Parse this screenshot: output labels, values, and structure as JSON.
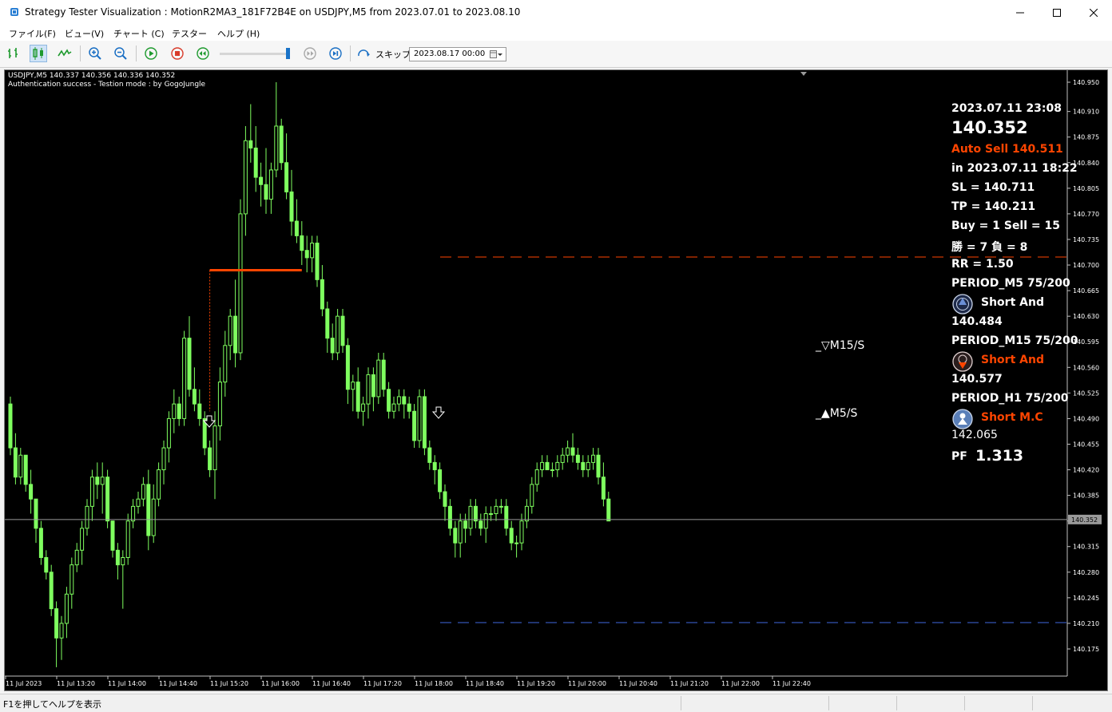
{
  "window": {
    "title": "Strategy Tester Visualization : MotionR2MA3_181F72B4E on USDJPY,M5 from 2023.07.01 to 2023.08.10"
  },
  "menu": [
    "ファイル(F)",
    "ビュー(V)",
    "チャート (C)",
    "テスター",
    "ヘルプ (H)"
  ],
  "toolbar": {
    "skip_label": "スキップ",
    "date_value": "2023.08.17 00:00",
    "slider_position": 0.97
  },
  "chart_header": {
    "symbol_line": "USDJPY,M5  140.337 140.356 140.336 140.352",
    "auth_line": "Authentication success - Testion mode : by GogoJungle"
  },
  "info_panel": {
    "datetime": "2023.07.11 23:08",
    "price": "140.352",
    "auto_sell": "Auto Sell 140.511",
    "in_time": "in 2023.07.11 18:22",
    "sl": "SL = 140.711",
    "tp": "TP = 140.211",
    "buy_sell": "Buy = 1 Sell = 15",
    "win_loss": "勝 = 7  負 = 8",
    "rr": "RR = 1.50",
    "period_m5": "PERIOD_M5 75/200",
    "m5_signal": "Short And",
    "m5_value": "140.484",
    "period_m15": "PERIOD_M15 75/200",
    "m15_signal": "Short And",
    "m15_value": "140.577",
    "period_h1": "PERIOD_H1 75/200",
    "h1_signal": "Short M.C",
    "h1_value": "142.065",
    "pf_label": "PF",
    "pf_value": "1.313"
  },
  "chart_labels": {
    "m15_label": "_▽M15/S",
    "m5_label": "_▲M5/S"
  },
  "status": {
    "help_text": "F1を押してヘルプを表示"
  },
  "colors": {
    "candle": "#7fff5f",
    "background": "#000000",
    "sl_line": "#ff4500",
    "tp_line": "#4169e1",
    "signal_red": "#ff4500",
    "text": "#ffffff"
  },
  "chart_data": {
    "type": "candlestick",
    "symbol": "USDJPY,M5",
    "current_price": 140.352,
    "y_ticks": [
      140.95,
      140.91,
      140.875,
      140.84,
      140.805,
      140.77,
      140.735,
      140.7,
      140.665,
      140.63,
      140.595,
      140.56,
      140.525,
      140.49,
      140.455,
      140.42,
      140.385,
      140.35,
      140.315,
      140.28,
      140.245,
      140.21,
      140.175
    ],
    "x_ticks": [
      "11 Jul 2023",
      "11 Jul 13:20",
      "11 Jul 14:00",
      "11 Jul 14:40",
      "11 Jul 15:20",
      "11 Jul 16:00",
      "11 Jul 16:40",
      "11 Jul 17:20",
      "11 Jul 18:00",
      "11 Jul 18:40",
      "11 Jul 19:20",
      "11 Jul 20:00",
      "11 Jul 20:40",
      "11 Jul 21:20",
      "11 Jul 22:00",
      "11 Jul 22:40"
    ],
    "sl_level": 140.711,
    "tp_level": 140.211,
    "entry_level": 140.693,
    "ohlc": [
      [
        140.51,
        140.52,
        140.44,
        140.45
      ],
      [
        140.45,
        140.47,
        140.4,
        140.41
      ],
      [
        140.41,
        140.45,
        140.4,
        140.44
      ],
      [
        140.44,
        140.44,
        140.39,
        140.4
      ],
      [
        140.4,
        140.42,
        140.36,
        140.38
      ],
      [
        140.38,
        140.38,
        140.32,
        140.34
      ],
      [
        140.34,
        140.35,
        140.29,
        140.3
      ],
      [
        140.3,
        140.31,
        140.27,
        140.28
      ],
      [
        140.28,
        140.29,
        140.22,
        140.23
      ],
      [
        140.23,
        140.24,
        140.15,
        140.19
      ],
      [
        140.19,
        140.22,
        140.16,
        140.21
      ],
      [
        140.21,
        140.26,
        140.19,
        140.25
      ],
      [
        140.25,
        140.3,
        140.23,
        140.29
      ],
      [
        140.29,
        140.32,
        140.28,
        140.31
      ],
      [
        140.31,
        140.35,
        140.29,
        140.34
      ],
      [
        140.34,
        140.38,
        140.33,
        140.37
      ],
      [
        140.37,
        140.42,
        140.35,
        140.41
      ],
      [
        140.41,
        140.43,
        140.38,
        140.4
      ],
      [
        140.4,
        140.43,
        140.36,
        140.41
      ],
      [
        140.41,
        140.42,
        140.34,
        140.35
      ],
      [
        140.35,
        140.35,
        140.3,
        140.31
      ],
      [
        140.31,
        140.32,
        140.27,
        140.29
      ],
      [
        140.29,
        140.31,
        140.23,
        140.3
      ],
      [
        140.3,
        140.36,
        140.29,
        140.35
      ],
      [
        140.35,
        140.38,
        140.34,
        140.37
      ],
      [
        140.37,
        140.39,
        140.36,
        140.38
      ],
      [
        140.38,
        140.41,
        140.37,
        140.4
      ],
      [
        140.4,
        140.42,
        140.31,
        140.33
      ],
      [
        140.33,
        140.4,
        140.32,
        140.38
      ],
      [
        140.38,
        140.43,
        140.37,
        140.42
      ],
      [
        140.42,
        140.46,
        140.4,
        140.45
      ],
      [
        140.45,
        140.5,
        140.43,
        140.49
      ],
      [
        140.49,
        140.53,
        140.47,
        140.51
      ],
      [
        140.51,
        140.52,
        140.48,
        140.49
      ],
      [
        140.49,
        140.61,
        140.48,
        140.6
      ],
      [
        140.6,
        140.63,
        140.52,
        140.53
      ],
      [
        140.53,
        140.56,
        140.5,
        140.51
      ],
      [
        140.51,
        140.53,
        140.48,
        140.49
      ],
      [
        140.49,
        140.5,
        140.44,
        140.45
      ],
      [
        140.45,
        140.46,
        140.41,
        140.42
      ],
      [
        140.42,
        140.5,
        140.38,
        140.48
      ],
      [
        140.48,
        140.56,
        140.46,
        140.54
      ],
      [
        140.54,
        140.61,
        140.52,
        140.59
      ],
      [
        140.59,
        140.64,
        140.57,
        140.63
      ],
      [
        140.63,
        140.68,
        140.56,
        140.58
      ],
      [
        140.58,
        140.79,
        140.57,
        140.77
      ],
      [
        140.77,
        140.89,
        140.74,
        140.87
      ],
      [
        140.87,
        140.92,
        140.84,
        140.86
      ],
      [
        140.86,
        140.89,
        140.8,
        140.82
      ],
      [
        140.82,
        140.84,
        140.78,
        140.81
      ],
      [
        140.81,
        140.86,
        140.77,
        140.79
      ],
      [
        140.79,
        140.84,
        140.77,
        140.83
      ],
      [
        140.83,
        140.95,
        140.82,
        140.89
      ],
      [
        140.89,
        140.9,
        140.83,
        140.84
      ],
      [
        140.84,
        140.88,
        140.79,
        140.8
      ],
      [
        140.8,
        140.83,
        140.74,
        140.76
      ],
      [
        140.76,
        140.79,
        140.73,
        140.74
      ],
      [
        140.74,
        140.76,
        140.7,
        140.72
      ],
      [
        140.72,
        140.74,
        140.69,
        140.71
      ],
      [
        140.71,
        140.74,
        140.69,
        140.73
      ],
      [
        140.73,
        140.74,
        140.67,
        140.68
      ],
      [
        140.68,
        140.7,
        140.63,
        140.64
      ],
      [
        140.64,
        140.65,
        140.58,
        140.6
      ],
      [
        140.6,
        140.62,
        140.57,
        140.58
      ],
      [
        140.58,
        140.64,
        140.57,
        140.63
      ],
      [
        140.63,
        140.64,
        140.58,
        140.59
      ],
      [
        140.59,
        140.6,
        140.51,
        140.53
      ],
      [
        140.53,
        140.55,
        140.5,
        140.54
      ],
      [
        140.54,
        140.56,
        140.49,
        140.5
      ],
      [
        140.5,
        140.52,
        140.48,
        140.51
      ],
      [
        140.51,
        140.56,
        140.49,
        140.55
      ],
      [
        140.55,
        140.56,
        140.5,
        140.52
      ],
      [
        140.52,
        140.58,
        140.51,
        140.57
      ],
      [
        140.57,
        140.58,
        140.52,
        140.53
      ],
      [
        140.53,
        140.54,
        140.49,
        140.5
      ],
      [
        140.5,
        140.52,
        140.49,
        140.51
      ],
      [
        140.51,
        140.53,
        140.5,
        140.52
      ],
      [
        140.52,
        140.53,
        140.49,
        140.51
      ],
      [
        140.51,
        140.52,
        140.49,
        140.5
      ],
      [
        140.5,
        140.51,
        140.45,
        140.46
      ],
      [
        140.46,
        140.53,
        140.45,
        140.52
      ],
      [
        140.52,
        140.53,
        140.44,
        140.45
      ],
      [
        140.45,
        140.46,
        140.42,
        140.43
      ],
      [
        140.43,
        140.44,
        140.4,
        140.42
      ],
      [
        140.42,
        140.43,
        140.38,
        140.39
      ],
      [
        140.39,
        140.4,
        140.35,
        140.37
      ],
      [
        140.37,
        140.38,
        140.33,
        140.34
      ],
      [
        140.34,
        140.35,
        140.3,
        140.32
      ],
      [
        140.32,
        140.36,
        140.3,
        140.35
      ],
      [
        140.35,
        140.36,
        140.32,
        140.34
      ],
      [
        140.34,
        140.38,
        140.33,
        140.37
      ],
      [
        140.37,
        140.38,
        140.34,
        140.35
      ],
      [
        140.35,
        140.36,
        140.33,
        140.34
      ],
      [
        140.34,
        140.37,
        140.32,
        140.36
      ],
      [
        140.36,
        140.37,
        140.35,
        140.36
      ],
      [
        140.36,
        140.38,
        140.35,
        140.37
      ],
      [
        140.37,
        140.38,
        140.36,
        140.37
      ],
      [
        140.37,
        140.38,
        140.33,
        140.34
      ],
      [
        140.34,
        140.35,
        140.31,
        140.32
      ],
      [
        140.32,
        140.33,
        140.3,
        140.32
      ],
      [
        140.32,
        140.36,
        140.31,
        140.35
      ],
      [
        140.35,
        140.38,
        140.34,
        140.37
      ],
      [
        140.37,
        140.41,
        140.36,
        140.4
      ],
      [
        140.4,
        140.43,
        140.39,
        140.42
      ],
      [
        140.42,
        140.44,
        140.41,
        140.43
      ],
      [
        140.43,
        140.44,
        140.42,
        140.42
      ],
      [
        140.42,
        140.43,
        140.41,
        140.42
      ],
      [
        140.42,
        140.44,
        140.41,
        140.43
      ],
      [
        140.43,
        140.45,
        140.42,
        140.44
      ],
      [
        140.44,
        140.46,
        140.43,
        140.45
      ],
      [
        140.45,
        140.47,
        140.43,
        140.44
      ],
      [
        140.44,
        140.45,
        140.42,
        140.43
      ],
      [
        140.43,
        140.44,
        140.41,
        140.42
      ],
      [
        140.42,
        140.44,
        140.41,
        140.43
      ],
      [
        140.43,
        140.45,
        140.42,
        140.44
      ],
      [
        140.44,
        140.45,
        140.4,
        140.41
      ],
      [
        140.41,
        140.43,
        140.37,
        140.38
      ],
      [
        140.38,
        140.39,
        140.35,
        140.35
      ]
    ]
  }
}
